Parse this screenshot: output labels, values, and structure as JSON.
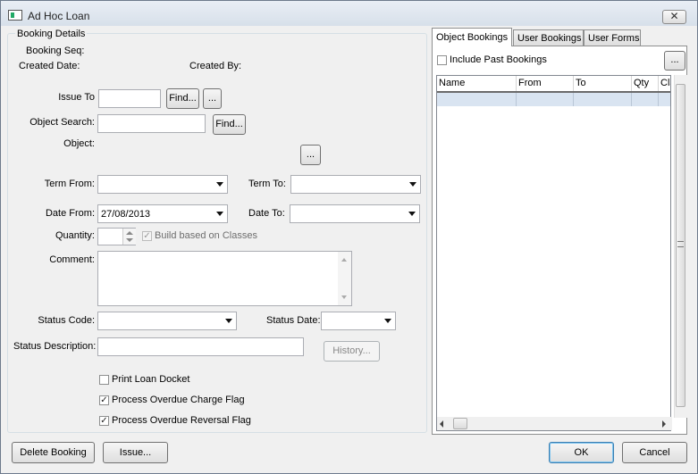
{
  "window": {
    "title": "Ad Hoc Loan",
    "close_glyph": "✕"
  },
  "booking": {
    "group_label": "Booking Details",
    "booking_seq_label": "Booking Seq:",
    "created_date_label": "Created Date:",
    "created_by_label": "Created By:",
    "issue_to_label": "Issue To",
    "issue_to_value": "",
    "find_label": "Find...",
    "ellipsis_label": "...",
    "object_search_label": "Object Search:",
    "object_search_value": "",
    "object_label": "Object:",
    "term_from_label": "Term From:",
    "term_from_value": "",
    "term_to_label": "Term To:",
    "term_to_value": "",
    "date_from_label": "Date From:",
    "date_from_value": "27/08/2013",
    "date_to_label": "Date To:",
    "date_to_value": "",
    "quantity_label": "Quantity:",
    "quantity_value": "",
    "build_on_classes_label": "Build based on Classes",
    "build_on_classes_checked": true,
    "comment_label": "Comment:",
    "comment_value": "",
    "status_code_label": "Status Code:",
    "status_code_value": "",
    "status_date_label": "Status Date:",
    "status_date_value": "",
    "status_description_label": "Status Description:",
    "status_description_value": "",
    "history_label": "History...",
    "print_loan_docket_label": "Print Loan Docket",
    "print_loan_docket_checked": false,
    "overdue_charge_label": "Process Overdue Charge Flag",
    "overdue_charge_checked": true,
    "overdue_reversal_label": "Process Overdue Reversal Flag",
    "overdue_reversal_checked": true
  },
  "tabs": [
    {
      "label": "Object Bookings",
      "active": true
    },
    {
      "label": "User Bookings",
      "active": false
    },
    {
      "label": "User Forms",
      "active": false
    }
  ],
  "object_bookings": {
    "include_past_label": "Include Past Bookings",
    "include_past_checked": false,
    "more_label": "...",
    "columns": [
      "Name",
      "From",
      "To",
      "Qty",
      "Cla"
    ]
  },
  "footer": {
    "delete_label": "Delete Booking",
    "issue_label": "Issue...",
    "ok_label": "OK",
    "cancel_label": "Cancel"
  },
  "check_glyph": "✓"
}
